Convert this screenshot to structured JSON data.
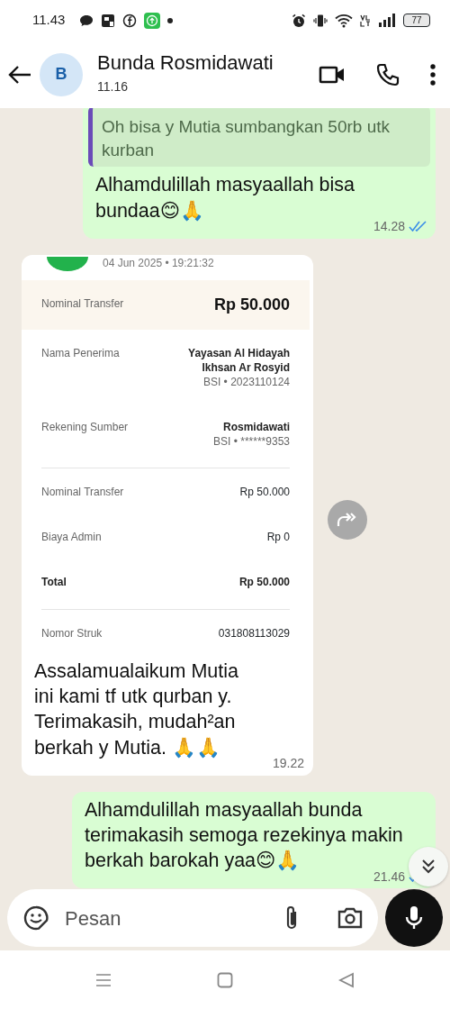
{
  "status_bar": {
    "time": "11.43",
    "battery": "77"
  },
  "header": {
    "avatar_letter": "B",
    "contact_name": "Bunda Rosmidawati",
    "last_seen": "11.16"
  },
  "messages": [
    {
      "kind": "outgoing",
      "quote": "Oh bisa y Mutia sumbangkan 50rb utk kurban",
      "text": "Alhamdulillah masyaallah bisa bundaa😊🙏",
      "time": "14.28",
      "read": true
    },
    {
      "kind": "incoming",
      "receipt": {
        "date": "04 Jun 2025 • 19:21:32",
        "rows": [
          {
            "kind": "highlight",
            "divider_before": false,
            "label": "Nominal Transfer",
            "values": [
              {
                "text": "Rp 50.000",
                "kind": "amount"
              }
            ]
          },
          {
            "kind": "plain",
            "divider_before": false,
            "label": "Nama Penerima",
            "values": [
              {
                "text": "Yayasan Al Hidayah",
                "kind": "name"
              },
              {
                "text": "Ikhsan Ar Rosyid",
                "kind": "name"
              },
              {
                "text": "BSI • 2023110124",
                "kind": "account"
              }
            ]
          },
          {
            "kind": "plain",
            "divider_before": false,
            "label": "Rekening Sumber",
            "values": [
              {
                "text": "Rosmidawati",
                "kind": "name"
              },
              {
                "text": "BSI • ******9353",
                "kind": "account"
              }
            ]
          },
          {
            "kind": "plain",
            "divider_before": true,
            "label": "Nominal Transfer",
            "values": [
              {
                "text": "Rp 50.000",
                "kind": "value"
              }
            ]
          },
          {
            "kind": "plain",
            "divider_before": false,
            "label": "Biaya Admin",
            "values": [
              {
                "text": "Rp 0",
                "kind": "value"
              }
            ]
          },
          {
            "kind": "total",
            "divider_before": false,
            "label": "Total",
            "values": [
              {
                "text": "Rp 50.000",
                "kind": "name"
              }
            ]
          },
          {
            "kind": "plain",
            "divider_before": true,
            "label": "Nomor Struk",
            "values": [
              {
                "text": "031808113029",
                "kind": "value"
              }
            ]
          }
        ]
      },
      "text": "Assalamualaikum Mutia ini kami tf utk qurban y. Terimakasih, mudah²an berkah y Mutia. 🙏🙏",
      "time": "19.22"
    },
    {
      "kind": "outgoing",
      "text": "Alhamdulillah masyaallah bunda terimakasih semoga rezekinya makin berkah barokah yaa😊🙏",
      "time": "21.46",
      "read": true
    }
  ],
  "composer": {
    "placeholder": "Pesan"
  }
}
